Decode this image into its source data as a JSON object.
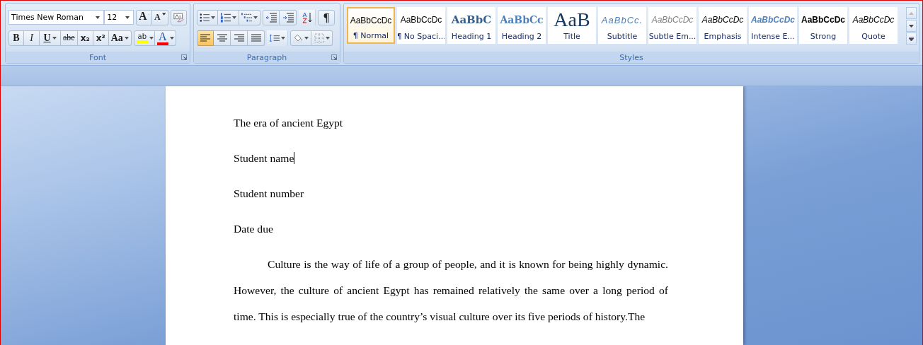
{
  "font": {
    "label": "Font",
    "font_name": "Times New Roman",
    "font_size": "12",
    "size_buttons": [
      {
        "glyph": "A",
        "kind": "grow"
      },
      {
        "glyph": "A",
        "kind": "shrink"
      }
    ],
    "format_buttons": [
      {
        "glyph": "B",
        "kind": "bold",
        "menu": false
      },
      {
        "glyph": "I",
        "kind": "italic",
        "menu": false
      },
      {
        "glyph": "U",
        "kind": "underline",
        "menu": true
      },
      {
        "glyph": "abe",
        "kind": "strike",
        "menu": false
      },
      {
        "glyph": "x₂",
        "kind": "sub",
        "menu": false
      },
      {
        "glyph": "x²",
        "kind": "sup",
        "menu": false
      },
      {
        "glyph": "Aa",
        "kind": "case",
        "menu": true
      }
    ],
    "color_buttons": [
      {
        "glyph": "ab",
        "kind": "highlight",
        "color": "#ffff00"
      },
      {
        "glyph": "A",
        "kind": "fontcolor",
        "color": "#ff0000"
      }
    ]
  },
  "paragraph": {
    "label": "Paragraph",
    "show_marks_glyph": "¶",
    "align_buttons": [
      {
        "kind": "left",
        "selected": true
      },
      {
        "kind": "center",
        "selected": false
      },
      {
        "kind": "right",
        "selected": false
      },
      {
        "kind": "justify",
        "selected": false
      }
    ]
  },
  "styles": {
    "label": "Styles",
    "items": [
      {
        "preview": "AaBbCcDc",
        "label": "¶ Normal",
        "kind": "normal",
        "selected": true
      },
      {
        "preview": "AaBbCcDc",
        "label": "¶ No Spaci...",
        "kind": "normal",
        "selected": false
      },
      {
        "preview": "AaBbC",
        "label": "Heading 1",
        "kind": "heading1",
        "selected": false
      },
      {
        "preview": "AaBbCc",
        "label": "Heading 2",
        "kind": "heading2",
        "selected": false
      },
      {
        "preview": "AaB",
        "label": "Title",
        "kind": "title",
        "selected": false
      },
      {
        "preview": "AaBbCc.",
        "label": "Subtitle",
        "kind": "subtitle",
        "selected": false
      },
      {
        "preview": "AaBbCcDc",
        "label": "Subtle Em...",
        "kind": "subtle",
        "selected": false
      },
      {
        "preview": "AaBbCcDc",
        "label": "Emphasis",
        "kind": "emphasis",
        "selected": false
      },
      {
        "preview": "AaBbCcDc",
        "label": "Intense E...",
        "kind": "intense",
        "selected": false
      },
      {
        "preview": "AaBbCcDc",
        "label": "Strong",
        "kind": "strong",
        "selected": false
      },
      {
        "preview": "AaBbCcDc",
        "label": "Quote",
        "kind": "quote",
        "selected": false
      }
    ]
  },
  "document": {
    "paragraphs": [
      {
        "kind": "line",
        "text": "The era of ancient Egypt",
        "cursor": false
      },
      {
        "kind": "line",
        "text": "Student name",
        "cursor": true
      },
      {
        "kind": "line",
        "text": "Student number",
        "cursor": false
      },
      {
        "kind": "line",
        "text": "Date due",
        "cursor": false
      },
      {
        "kind": "body",
        "text": "Culture is the way of life of a group of people, and it is known for being highly dynamic. However, the culture of ancient Egypt has remained relatively the same over a long period of time. This is especially true of the country’s visual culture over its five periods of history.The",
        "cursor": false
      }
    ]
  }
}
